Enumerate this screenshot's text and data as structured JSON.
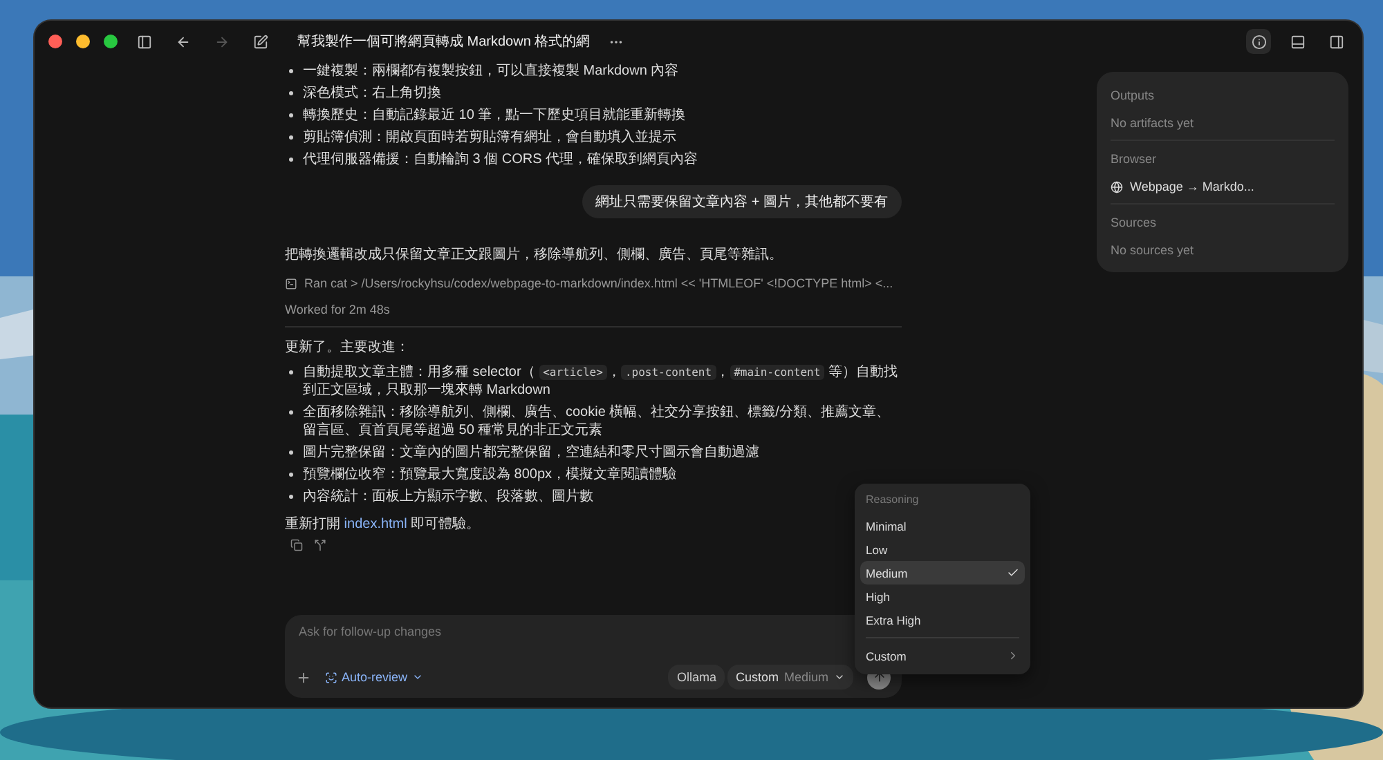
{
  "window": {
    "title": "幫我製作一個可將網頁轉成 Markdown 格式的網"
  },
  "conversation": {
    "earlier_bullets": [
      "一鍵複製：兩欄都有複製按鈕，可以直接複製 Markdown 內容",
      "深色模式：右上角切換",
      "轉換歷史：自動記錄最近 10 筆，點一下歷史項目就能重新轉換",
      "剪貼簿偵測：開啟頁面時若剪貼簿有網址，會自動填入並提示",
      "代理伺服器備援：自動輪詢 3 個 CORS 代理，確保取到網頁內容"
    ],
    "user_message": "網址只需要保留文章內容 + 圖片，其他都不要有",
    "summary": "把轉換邏輯改成只保留文章正文跟圖片，移除導航列、側欄、廣告、頁尾等雜訊。",
    "command": "Ran cat > /Users/rockyhsu/codex/webpage-to-markdown/index.html << 'HTMLEOF' <!DOCTYPE html> <...",
    "worked": "Worked for 2m 48s",
    "intro": "更新了。主要改進：",
    "bullets": [
      [
        {
          "kind": "text",
          "text": "自動提取文章主體：用多種 selector（ "
        },
        {
          "kind": "code",
          "text": "<article>"
        },
        {
          "kind": "text",
          "text": "，"
        },
        {
          "kind": "code",
          "text": ".post-content"
        },
        {
          "kind": "text",
          "text": "，"
        },
        {
          "kind": "code",
          "text": "#main-content"
        },
        {
          "kind": "text",
          "text": " 等）自動找到正文區域，只取那一塊來轉 Markdown"
        }
      ],
      [
        {
          "kind": "text",
          "text": "全面移除雜訊：移除導航列、側欄、廣告、cookie 橫幅、社交分享按鈕、標籤/分類、推薦文章、留言區、頁首頁尾等超過 50 種常見的非正文元素"
        }
      ],
      [
        {
          "kind": "text",
          "text": "圖片完整保留：文章內的圖片都完整保留，空連結和零尺寸圖示會自動過濾"
        }
      ],
      [
        {
          "kind": "text",
          "text": "預覽欄位收窄：預覽最大寬度設為 800px，模擬文章閱讀體驗"
        }
      ],
      [
        {
          "kind": "text",
          "text": "內容統計：面板上方顯示字數、段落數、圖片數"
        }
      ]
    ],
    "closing": {
      "before": "重新打開",
      "link": "index.html",
      "after": "即可體驗。"
    }
  },
  "side_panel": [
    {
      "heading": "Outputs",
      "items": [
        {
          "kind": "empty",
          "text": "No artifacts yet"
        }
      ]
    },
    {
      "heading": "Browser",
      "items": [
        {
          "kind": "page",
          "text": "Webpage → Markdo..."
        }
      ]
    },
    {
      "heading": "Sources",
      "items": [
        {
          "kind": "empty",
          "text": "No sources yet"
        }
      ]
    }
  ],
  "composer": {
    "placeholder": "Ask for follow-up changes",
    "review": "Auto-review",
    "provider": "Ollama",
    "model": "Custom",
    "effort": "Medium"
  },
  "reasoning_menu": {
    "title": "Reasoning",
    "options": [
      {
        "label": "Minimal",
        "selected": false
      },
      {
        "label": "Low",
        "selected": false
      },
      {
        "label": "Medium",
        "selected": true
      },
      {
        "label": "High",
        "selected": false
      },
      {
        "label": "Extra High",
        "selected": false
      }
    ],
    "submenu": "Custom"
  }
}
